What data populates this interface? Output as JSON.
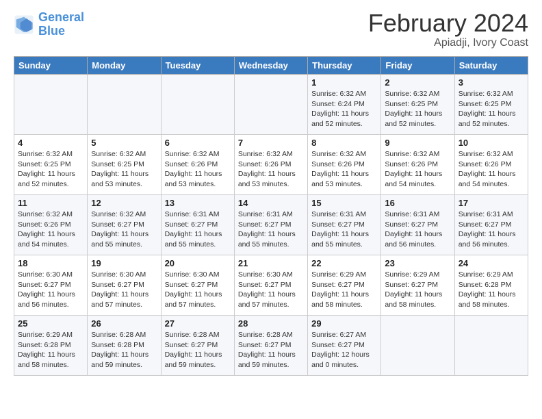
{
  "logo": {
    "line1": "General",
    "line2": "Blue"
  },
  "title": "February 2024",
  "subtitle": "Apiadji, Ivory Coast",
  "days_of_week": [
    "Sunday",
    "Monday",
    "Tuesday",
    "Wednesday",
    "Thursday",
    "Friday",
    "Saturday"
  ],
  "weeks": [
    [
      {
        "day": "",
        "info": ""
      },
      {
        "day": "",
        "info": ""
      },
      {
        "day": "",
        "info": ""
      },
      {
        "day": "",
        "info": ""
      },
      {
        "day": "1",
        "info": "Sunrise: 6:32 AM\nSunset: 6:24 PM\nDaylight: 11 hours\nand 52 minutes."
      },
      {
        "day": "2",
        "info": "Sunrise: 6:32 AM\nSunset: 6:25 PM\nDaylight: 11 hours\nand 52 minutes."
      },
      {
        "day": "3",
        "info": "Sunrise: 6:32 AM\nSunset: 6:25 PM\nDaylight: 11 hours\nand 52 minutes."
      }
    ],
    [
      {
        "day": "4",
        "info": "Sunrise: 6:32 AM\nSunset: 6:25 PM\nDaylight: 11 hours\nand 52 minutes."
      },
      {
        "day": "5",
        "info": "Sunrise: 6:32 AM\nSunset: 6:25 PM\nDaylight: 11 hours\nand 53 minutes."
      },
      {
        "day": "6",
        "info": "Sunrise: 6:32 AM\nSunset: 6:26 PM\nDaylight: 11 hours\nand 53 minutes."
      },
      {
        "day": "7",
        "info": "Sunrise: 6:32 AM\nSunset: 6:26 PM\nDaylight: 11 hours\nand 53 minutes."
      },
      {
        "day": "8",
        "info": "Sunrise: 6:32 AM\nSunset: 6:26 PM\nDaylight: 11 hours\nand 53 minutes."
      },
      {
        "day": "9",
        "info": "Sunrise: 6:32 AM\nSunset: 6:26 PM\nDaylight: 11 hours\nand 54 minutes."
      },
      {
        "day": "10",
        "info": "Sunrise: 6:32 AM\nSunset: 6:26 PM\nDaylight: 11 hours\nand 54 minutes."
      }
    ],
    [
      {
        "day": "11",
        "info": "Sunrise: 6:32 AM\nSunset: 6:26 PM\nDaylight: 11 hours\nand 54 minutes."
      },
      {
        "day": "12",
        "info": "Sunrise: 6:32 AM\nSunset: 6:27 PM\nDaylight: 11 hours\nand 55 minutes."
      },
      {
        "day": "13",
        "info": "Sunrise: 6:31 AM\nSunset: 6:27 PM\nDaylight: 11 hours\nand 55 minutes."
      },
      {
        "day": "14",
        "info": "Sunrise: 6:31 AM\nSunset: 6:27 PM\nDaylight: 11 hours\nand 55 minutes."
      },
      {
        "day": "15",
        "info": "Sunrise: 6:31 AM\nSunset: 6:27 PM\nDaylight: 11 hours\nand 55 minutes."
      },
      {
        "day": "16",
        "info": "Sunrise: 6:31 AM\nSunset: 6:27 PM\nDaylight: 11 hours\nand 56 minutes."
      },
      {
        "day": "17",
        "info": "Sunrise: 6:31 AM\nSunset: 6:27 PM\nDaylight: 11 hours\nand 56 minutes."
      }
    ],
    [
      {
        "day": "18",
        "info": "Sunrise: 6:30 AM\nSunset: 6:27 PM\nDaylight: 11 hours\nand 56 minutes."
      },
      {
        "day": "19",
        "info": "Sunrise: 6:30 AM\nSunset: 6:27 PM\nDaylight: 11 hours\nand 57 minutes."
      },
      {
        "day": "20",
        "info": "Sunrise: 6:30 AM\nSunset: 6:27 PM\nDaylight: 11 hours\nand 57 minutes."
      },
      {
        "day": "21",
        "info": "Sunrise: 6:30 AM\nSunset: 6:27 PM\nDaylight: 11 hours\nand 57 minutes."
      },
      {
        "day": "22",
        "info": "Sunrise: 6:29 AM\nSunset: 6:27 PM\nDaylight: 11 hours\nand 58 minutes."
      },
      {
        "day": "23",
        "info": "Sunrise: 6:29 AM\nSunset: 6:27 PM\nDaylight: 11 hours\nand 58 minutes."
      },
      {
        "day": "24",
        "info": "Sunrise: 6:29 AM\nSunset: 6:28 PM\nDaylight: 11 hours\nand 58 minutes."
      }
    ],
    [
      {
        "day": "25",
        "info": "Sunrise: 6:29 AM\nSunset: 6:28 PM\nDaylight: 11 hours\nand 58 minutes."
      },
      {
        "day": "26",
        "info": "Sunrise: 6:28 AM\nSunset: 6:28 PM\nDaylight: 11 hours\nand 59 minutes."
      },
      {
        "day": "27",
        "info": "Sunrise: 6:28 AM\nSunset: 6:27 PM\nDaylight: 11 hours\nand 59 minutes."
      },
      {
        "day": "28",
        "info": "Sunrise: 6:28 AM\nSunset: 6:27 PM\nDaylight: 11 hours\nand 59 minutes."
      },
      {
        "day": "29",
        "info": "Sunrise: 6:27 AM\nSunset: 6:27 PM\nDaylight: 12 hours\nand 0 minutes."
      },
      {
        "day": "",
        "info": ""
      },
      {
        "day": "",
        "info": ""
      }
    ]
  ]
}
